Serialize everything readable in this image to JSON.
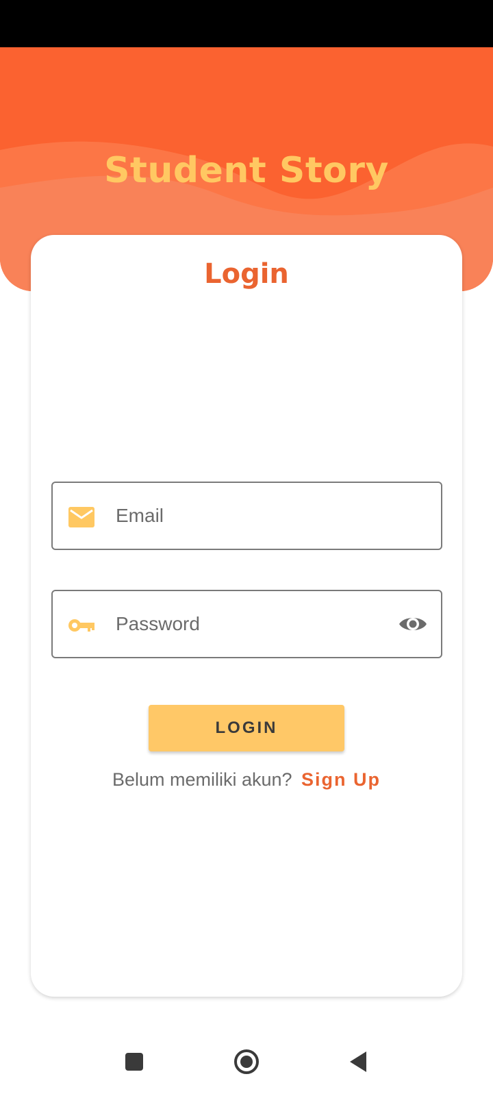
{
  "header": {
    "title": "Student Story"
  },
  "card": {
    "title": "Login",
    "email_field": {
      "placeholder": "Email",
      "icon": "mail-icon"
    },
    "password_field": {
      "placeholder": "Password",
      "icon": "key-icon",
      "toggle_icon": "eye-icon"
    },
    "login_button": "LOGIN",
    "signup_prompt": "Belum memiliki akun?",
    "signup_link": "Sign Up"
  },
  "nav": {
    "recents_icon": "square-icon",
    "home_icon": "circle-home-icon",
    "back_icon": "back-triangle-icon"
  },
  "colors": {
    "primary": "#fb6230",
    "accent": "#ffc862",
    "title": "#ea6430"
  }
}
